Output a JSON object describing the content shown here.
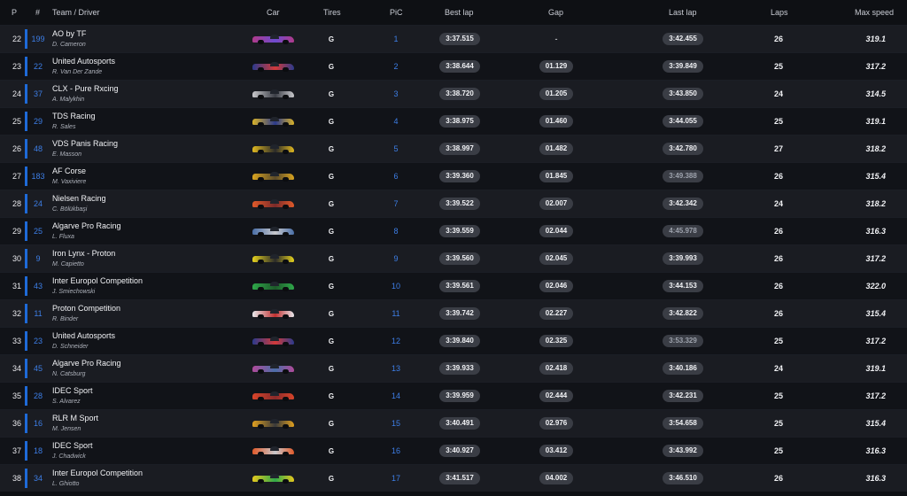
{
  "headers": {
    "p": "P",
    "num": "#",
    "team": "Team / Driver",
    "car": "Car",
    "tires": "Tires",
    "pic": "PiC",
    "best": "Best lap",
    "gap": "Gap",
    "last": "Last lap",
    "laps": "Laps",
    "max": "Max speed"
  },
  "rows": [
    {
      "p": "22",
      "num": "199",
      "team": "AO by TF",
      "driver": "D. Cameron",
      "car_colors": [
        "#b03a8a",
        "#6d4bd0"
      ],
      "tires": "G",
      "pic": "1",
      "best": "3:37.515",
      "gap": "-",
      "last": "3:42.455",
      "last_dim": false,
      "laps": "26",
      "max": "319.1"
    },
    {
      "p": "23",
      "num": "22",
      "team": "United Autosports",
      "driver": "R. Van Der Zande",
      "car_colors": [
        "#2b3a8c",
        "#d33a3a"
      ],
      "tires": "G",
      "pic": "2",
      "best": "3:38.644",
      "gap": "01.129",
      "last": "3:39.849",
      "last_dim": false,
      "laps": "25",
      "max": "317.2"
    },
    {
      "p": "24",
      "num": "37",
      "team": "CLX - Pure Rxcing",
      "driver": "A. Malykhin",
      "car_colors": [
        "#c8c8cc",
        "#3a3d45"
      ],
      "tires": "G",
      "pic": "3",
      "best": "3:38.720",
      "gap": "01.205",
      "last": "3:43.850",
      "last_dim": false,
      "laps": "24",
      "max": "314.5"
    },
    {
      "p": "25",
      "num": "29",
      "team": "TDS Racing",
      "driver": "R. Sales",
      "car_colors": [
        "#d8b22a",
        "#2b3a8c"
      ],
      "tires": "G",
      "pic": "4",
      "best": "3:38.975",
      "gap": "01.460",
      "last": "3:44.055",
      "last_dim": false,
      "laps": "25",
      "max": "319.1"
    },
    {
      "p": "26",
      "num": "48",
      "team": "VDS Panis Racing",
      "driver": "E. Masson",
      "car_colors": [
        "#e0b820",
        "#2a2a2a"
      ],
      "tires": "G",
      "pic": "5",
      "best": "3:38.997",
      "gap": "01.482",
      "last": "3:42.780",
      "last_dim": false,
      "laps": "27",
      "max": "318.2"
    },
    {
      "p": "27",
      "num": "183",
      "team": "AF Corse",
      "driver": "M. Vaxiviere",
      "car_colors": [
        "#d9a420",
        "#5a4a2a"
      ],
      "tires": "G",
      "pic": "6",
      "best": "3:39.360",
      "gap": "01.845",
      "last": "3:49.388",
      "last_dim": true,
      "laps": "26",
      "max": "315.4"
    },
    {
      "p": "28",
      "num": "24",
      "team": "Nielsen Racing",
      "driver": "C. Bölükbaşi",
      "car_colors": [
        "#e05a2a",
        "#7a2a2a"
      ],
      "tires": "G",
      "pic": "7",
      "best": "3:39.522",
      "gap": "02.007",
      "last": "3:42.342",
      "last_dim": false,
      "laps": "24",
      "max": "318.2"
    },
    {
      "p": "29",
      "num": "25",
      "team": "Algarve Pro Racing",
      "driver": "L. Fluxa",
      "car_colors": [
        "#4a6fa8",
        "#c8c8cc"
      ],
      "tires": "G",
      "pic": "8",
      "best": "3:39.559",
      "gap": "02.044",
      "last": "4:45.978",
      "last_dim": true,
      "laps": "26",
      "max": "316.3"
    },
    {
      "p": "30",
      "num": "9",
      "team": "Iron Lynx - Proton",
      "driver": "M. Capietto",
      "car_colors": [
        "#e6d21e",
        "#2a2a2a"
      ],
      "tires": "G",
      "pic": "9",
      "best": "3:39.560",
      "gap": "02.045",
      "last": "3:39.993",
      "last_dim": false,
      "laps": "26",
      "max": "317.2"
    },
    {
      "p": "31",
      "num": "43",
      "team": "Inter Europol Competition",
      "driver": "J. Smiechowski",
      "car_colors": [
        "#2fa84a",
        "#1d5a2a"
      ],
      "tires": "G",
      "pic": "10",
      "best": "3:39.561",
      "gap": "02.046",
      "last": "3:44.153",
      "last_dim": false,
      "laps": "26",
      "max": "322.0"
    },
    {
      "p": "32",
      "num": "11",
      "team": "Proton Competition",
      "driver": "R. Binder",
      "car_colors": [
        "#e8e8ec",
        "#c03030"
      ],
      "tires": "G",
      "pic": "11",
      "best": "3:39.742",
      "gap": "02.227",
      "last": "3:42.822",
      "last_dim": false,
      "laps": "26",
      "max": "315.4"
    },
    {
      "p": "33",
      "num": "23",
      "team": "United Autosports",
      "driver": "D. Schneider",
      "car_colors": [
        "#2b3a8c",
        "#d33a3a"
      ],
      "tires": "G",
      "pic": "12",
      "best": "3:39.840",
      "gap": "02.325",
      "last": "3:53.329",
      "last_dim": true,
      "laps": "25",
      "max": "317.2"
    },
    {
      "p": "34",
      "num": "45",
      "team": "Algarve Pro Racing",
      "driver": "N. Catsburg",
      "car_colors": [
        "#b04a9a",
        "#4a6fa8"
      ],
      "tires": "G",
      "pic": "13",
      "best": "3:39.933",
      "gap": "02.418",
      "last": "3:40.186",
      "last_dim": false,
      "laps": "24",
      "max": "319.1"
    },
    {
      "p": "35",
      "num": "28",
      "team": "IDEC Sport",
      "driver": "S. Alvarez",
      "car_colors": [
        "#d8452a",
        "#8a2a2a"
      ],
      "tires": "G",
      "pic": "14",
      "best": "3:39.959",
      "gap": "02.444",
      "last": "3:42.231",
      "last_dim": false,
      "laps": "25",
      "max": "317.2"
    },
    {
      "p": "36",
      "num": "16",
      "team": "RLR M Sport",
      "driver": "M. Jensen",
      "car_colors": [
        "#e0a020",
        "#3a3a3a"
      ],
      "tires": "G",
      "pic": "15",
      "best": "3:40.491",
      "gap": "02.976",
      "last": "3:54.658",
      "last_dim": false,
      "laps": "25",
      "max": "315.4"
    },
    {
      "p": "37",
      "num": "18",
      "team": "IDEC Sport",
      "driver": "J. Chadwick",
      "car_colors": [
        "#e05a2a",
        "#c8c8cc"
      ],
      "tires": "G",
      "pic": "16",
      "best": "3:40.927",
      "gap": "03.412",
      "last": "3:43.992",
      "last_dim": false,
      "laps": "25",
      "max": "316.3"
    },
    {
      "p": "38",
      "num": "34",
      "team": "Inter Europol Competition",
      "driver": "L. Ghiotto",
      "car_colors": [
        "#e6c81e",
        "#2fa84a"
      ],
      "tires": "G",
      "pic": "17",
      "best": "3:41.517",
      "gap": "04.002",
      "last": "3:46.510",
      "last_dim": false,
      "laps": "26",
      "max": "316.3"
    }
  ]
}
